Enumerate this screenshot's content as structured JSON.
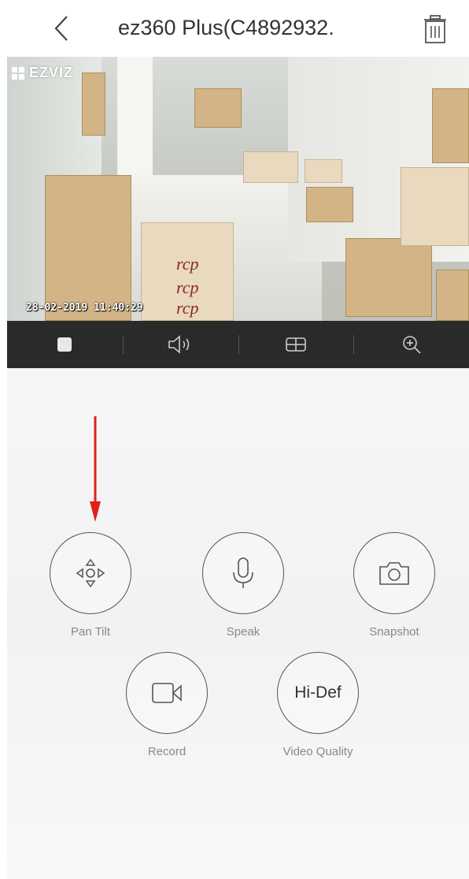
{
  "header": {
    "title": "ez360 Plus(C4892932.",
    "back_icon": "chevron-left-icon",
    "delete_icon": "trash-icon"
  },
  "video": {
    "brand": "EZVIZ",
    "timestamp": "28-02-2019 11:40:29",
    "box_print": "rcp"
  },
  "toolbar": {
    "items": [
      {
        "icon": "stop-icon"
      },
      {
        "icon": "speaker-icon"
      },
      {
        "icon": "multi-view-icon"
      },
      {
        "icon": "zoom-in-icon"
      }
    ]
  },
  "controls": {
    "pan_tilt": {
      "label": "Pan Tilt",
      "icon": "pan-tilt-icon"
    },
    "speak": {
      "label": "Speak",
      "icon": "microphone-icon"
    },
    "snapshot": {
      "label": "Snapshot",
      "icon": "camera-icon"
    },
    "record": {
      "label": "Record",
      "icon": "video-camera-icon"
    },
    "quality": {
      "label": "Video Quality",
      "value": "Hi-Def"
    }
  },
  "colors": {
    "annotation_arrow": "#e0201c",
    "toolbar_bg": "#2a2a2a"
  }
}
